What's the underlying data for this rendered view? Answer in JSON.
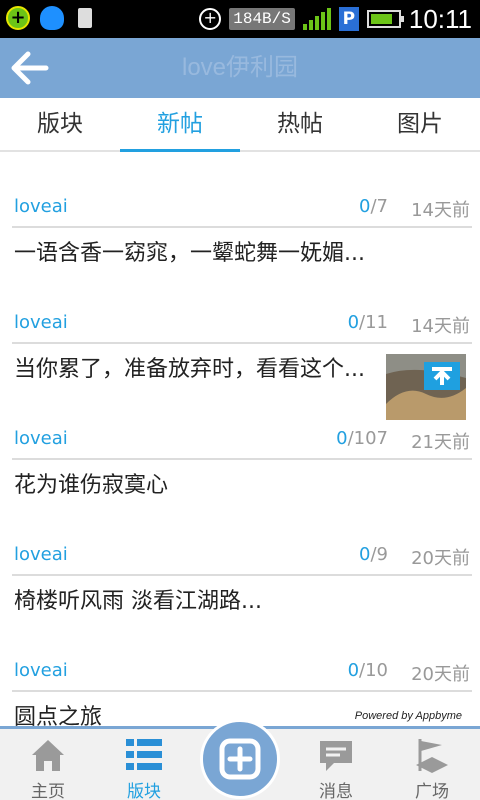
{
  "status_bar": {
    "net_speed": "184B/S",
    "time": "10:11",
    "icons": [
      "plus-app-icon",
      "qq-icon",
      "sd-card-icon",
      "data-sync-icon",
      "signal-icon",
      "p-notification-icon",
      "battery-icon"
    ],
    "colors": {
      "signal": "#6cc417",
      "battery": "#6cc417"
    }
  },
  "header": {
    "title": "love伊利园",
    "back_icon": "arrow-left-icon",
    "background": "#7aa6d4"
  },
  "tabs": [
    {
      "label": "版块",
      "active": false
    },
    {
      "label": "新帖",
      "active": true
    },
    {
      "label": "热帖",
      "active": false
    },
    {
      "label": "图片",
      "active": false
    }
  ],
  "posts": [
    {
      "author": "loveai",
      "replies": "0",
      "views": "/7",
      "time": "14天前",
      "title": "一语含香一窈窕，一颦蛇舞一妩媚..."
    },
    {
      "author": "loveai",
      "replies": "0",
      "views": "/11",
      "time": "14天前",
      "title": "当你累了，准备放弃时，看看这个...",
      "has_thumbnail": true
    },
    {
      "author": "loveai",
      "replies": "0",
      "views": "/107",
      "time": "21天前",
      "title": "花为谁伤寂寞心"
    },
    {
      "author": "loveai",
      "replies": "0",
      "views": "/9",
      "time": "20天前",
      "title": "椅楼听风雨 淡看江湖路..."
    },
    {
      "author": "loveai",
      "replies": "0",
      "views": "/10",
      "time": "20天前",
      "title": "圆点之旅"
    }
  ],
  "powered_by": "Powered by Appbyme",
  "bottom_nav": {
    "items": [
      {
        "label": "主页",
        "icon": "home-icon",
        "active": false
      },
      {
        "label": "版块",
        "icon": "list-icon",
        "active": true
      },
      {
        "label": "",
        "icon": "add-post-icon",
        "active": false
      },
      {
        "label": "消息",
        "icon": "message-icon",
        "active": false
      },
      {
        "label": "广场",
        "icon": "square-flag-icon",
        "active": false
      }
    ]
  },
  "colors": {
    "accent": "#22a0e0",
    "header": "#7aa6d4"
  }
}
